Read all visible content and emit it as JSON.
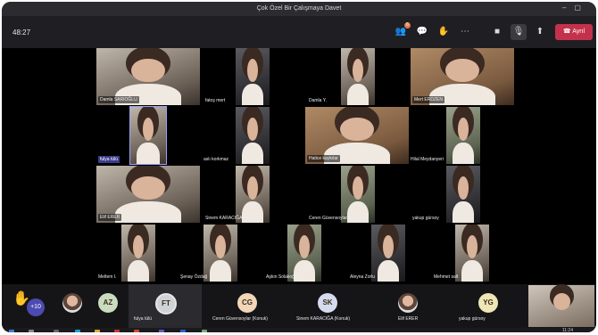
{
  "window": {
    "title": "Çok Özel Bir Çalışmaya Davet"
  },
  "toolbar": {
    "timer": "48:27",
    "participants_badge": "6",
    "leave_label": "Ayrıl"
  },
  "tiles": [
    {
      "name": "Damla SARIOĞLU"
    },
    {
      "name": "fatoş mert"
    },
    {
      "name": "Damla Y."
    },
    {
      "name": "Mert ERDZEN"
    },
    {
      "name": "fulya tülü"
    },
    {
      "name": "aslı korkmaz"
    },
    {
      "name": "Hatice kaykılar"
    },
    {
      "name": "Hilal Meydanyeri"
    },
    {
      "name": "Elif ERER"
    },
    {
      "name": "Sinem KARACIĞA"
    },
    {
      "name": "Ceren Güvensoylar"
    },
    {
      "name": "yakup gürsoy"
    },
    {
      "name": "Meltem I."
    },
    {
      "name": "Şenay Özdağ"
    },
    {
      "name": "Aşkın Solakoğlu"
    },
    {
      "name": "Aleyna Zorlu"
    },
    {
      "name": "Mehmet salt"
    }
  ],
  "bottom_bar": {
    "more_count": "+10",
    "people": [
      {
        "initials": "",
        "label": ""
      },
      {
        "initials": "AZ",
        "label": ""
      },
      {
        "initials": "FT",
        "label": "fulya tülü"
      },
      {
        "initials": "CG",
        "label": "Ceren Güvensoylar (Konuk)"
      },
      {
        "initials": "SK",
        "label": "Sinem KARACIĞA (Konuk)"
      },
      {
        "initials": "",
        "label": "Elif ERER"
      },
      {
        "initials": "YG",
        "label": "yakup gürsoy"
      }
    ]
  },
  "taskbar": {
    "time": "11:24"
  },
  "colors": {
    "leave": "#c4314b",
    "accent": "#4b4bb2"
  }
}
